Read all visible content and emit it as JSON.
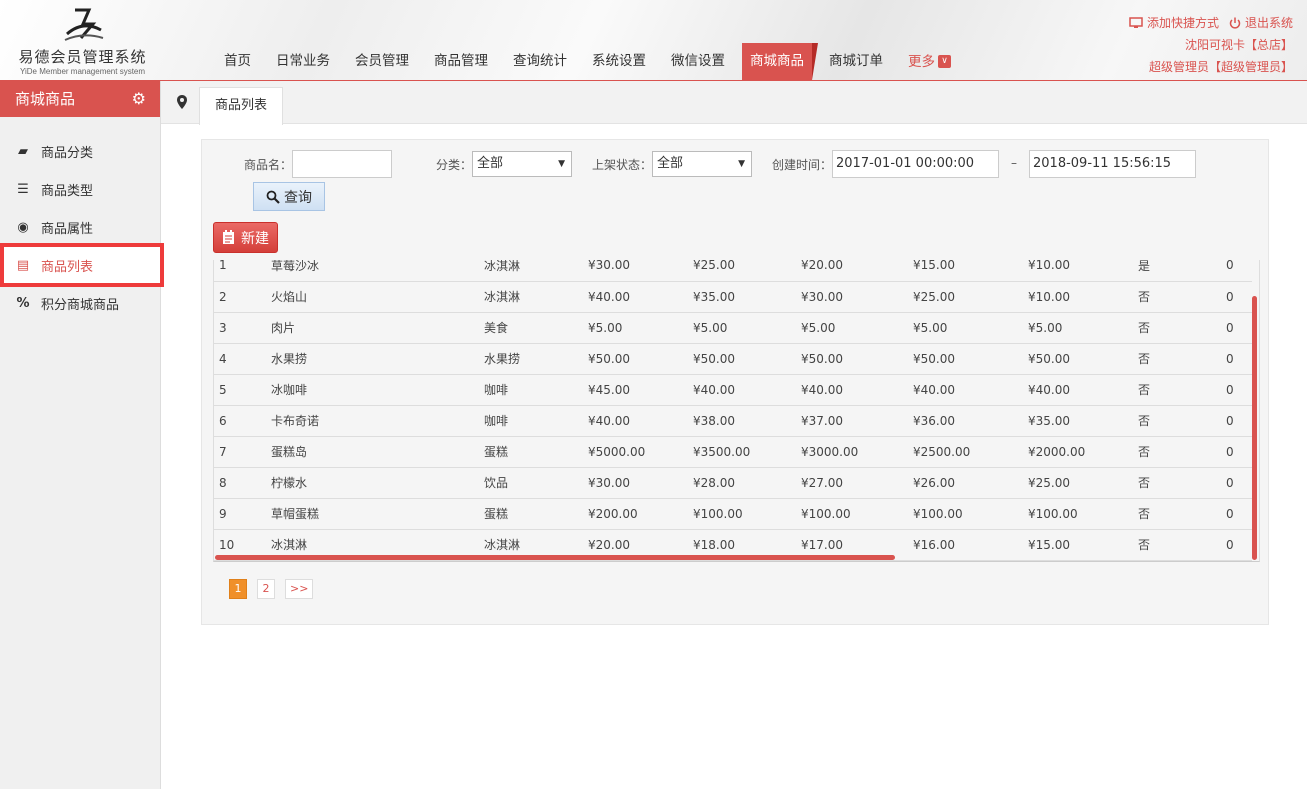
{
  "header": {
    "logo_title": "易德会员管理系统",
    "logo_sub": "YiDe Member management system",
    "nav": [
      "首页",
      "日常业务",
      "会员管理",
      "商品管理",
      "查询统计",
      "系统设置",
      "微信设置",
      "商城商品",
      "商城订单",
      "更多"
    ],
    "active_nav": "商城商品",
    "add_shortcut": "添加快捷方式",
    "logout": "退出系统",
    "store": "沈阳可视卡【总店】",
    "user": "超级管理员【超级管理员】"
  },
  "sidebar": {
    "title": "商城商品",
    "items": [
      {
        "label": "商品分类",
        "icon": "image-icon"
      },
      {
        "label": "商品类型",
        "icon": "list-icon"
      },
      {
        "label": "商品属性",
        "icon": "coins-icon"
      },
      {
        "label": "商品列表",
        "icon": "grid-list-icon",
        "active": true
      },
      {
        "label": "积分商城商品",
        "icon": "percent-icon"
      }
    ]
  },
  "tabs": {
    "current": "商品列表"
  },
  "filters": {
    "name_label": "商品名：",
    "name_value": "",
    "category_label": "分类：",
    "category_value": "全部",
    "status_label": "上架状态：",
    "status_value": "全部",
    "created_label": "创建时间：",
    "date_from": "2017-01-01 00:00:00",
    "date_sep": "–",
    "date_to": "2018-09-11 15:56:15",
    "query_btn": "查询",
    "new_btn": "新建"
  },
  "table": {
    "rows": [
      [
        "1",
        "草莓沙冰",
        "冰淇淋",
        "¥30.00",
        "¥25.00",
        "¥20.00",
        "¥15.00",
        "¥10.00",
        "是",
        "0"
      ],
      [
        "2",
        "火焰山",
        "冰淇淋",
        "¥40.00",
        "¥35.00",
        "¥30.00",
        "¥25.00",
        "¥10.00",
        "否",
        "0"
      ],
      [
        "3",
        "肉片",
        "美食",
        "¥5.00",
        "¥5.00",
        "¥5.00",
        "¥5.00",
        "¥5.00",
        "否",
        "0"
      ],
      [
        "4",
        "水果捞",
        "水果捞",
        "¥50.00",
        "¥50.00",
        "¥50.00",
        "¥50.00",
        "¥50.00",
        "否",
        "0"
      ],
      [
        "5",
        "冰咖啡",
        "咖啡",
        "¥45.00",
        "¥40.00",
        "¥40.00",
        "¥40.00",
        "¥40.00",
        "否",
        "0"
      ],
      [
        "6",
        "卡布奇诺",
        "咖啡",
        "¥40.00",
        "¥38.00",
        "¥37.00",
        "¥36.00",
        "¥35.00",
        "否",
        "0"
      ],
      [
        "7",
        "蛋糕岛",
        "蛋糕",
        "¥5000.00",
        "¥3500.00",
        "¥3000.00",
        "¥2500.00",
        "¥2000.00",
        "否",
        "0"
      ],
      [
        "8",
        "柠檬水",
        "饮品",
        "¥30.00",
        "¥28.00",
        "¥27.00",
        "¥26.00",
        "¥25.00",
        "否",
        "0"
      ],
      [
        "9",
        "草帽蛋糕",
        "蛋糕",
        "¥200.00",
        "¥100.00",
        "¥100.00",
        "¥100.00",
        "¥100.00",
        "否",
        "0"
      ],
      [
        "10",
        "冰淇淋",
        "冰淇淋",
        "¥20.00",
        "¥18.00",
        "¥17.00",
        "¥16.00",
        "¥15.00",
        "否",
        "0"
      ]
    ]
  },
  "pager": {
    "pages": [
      "1",
      "2"
    ],
    "current": "1",
    "next": ">>"
  },
  "colors": {
    "accent": "#d9534f",
    "pager_current": "#f0902a"
  }
}
